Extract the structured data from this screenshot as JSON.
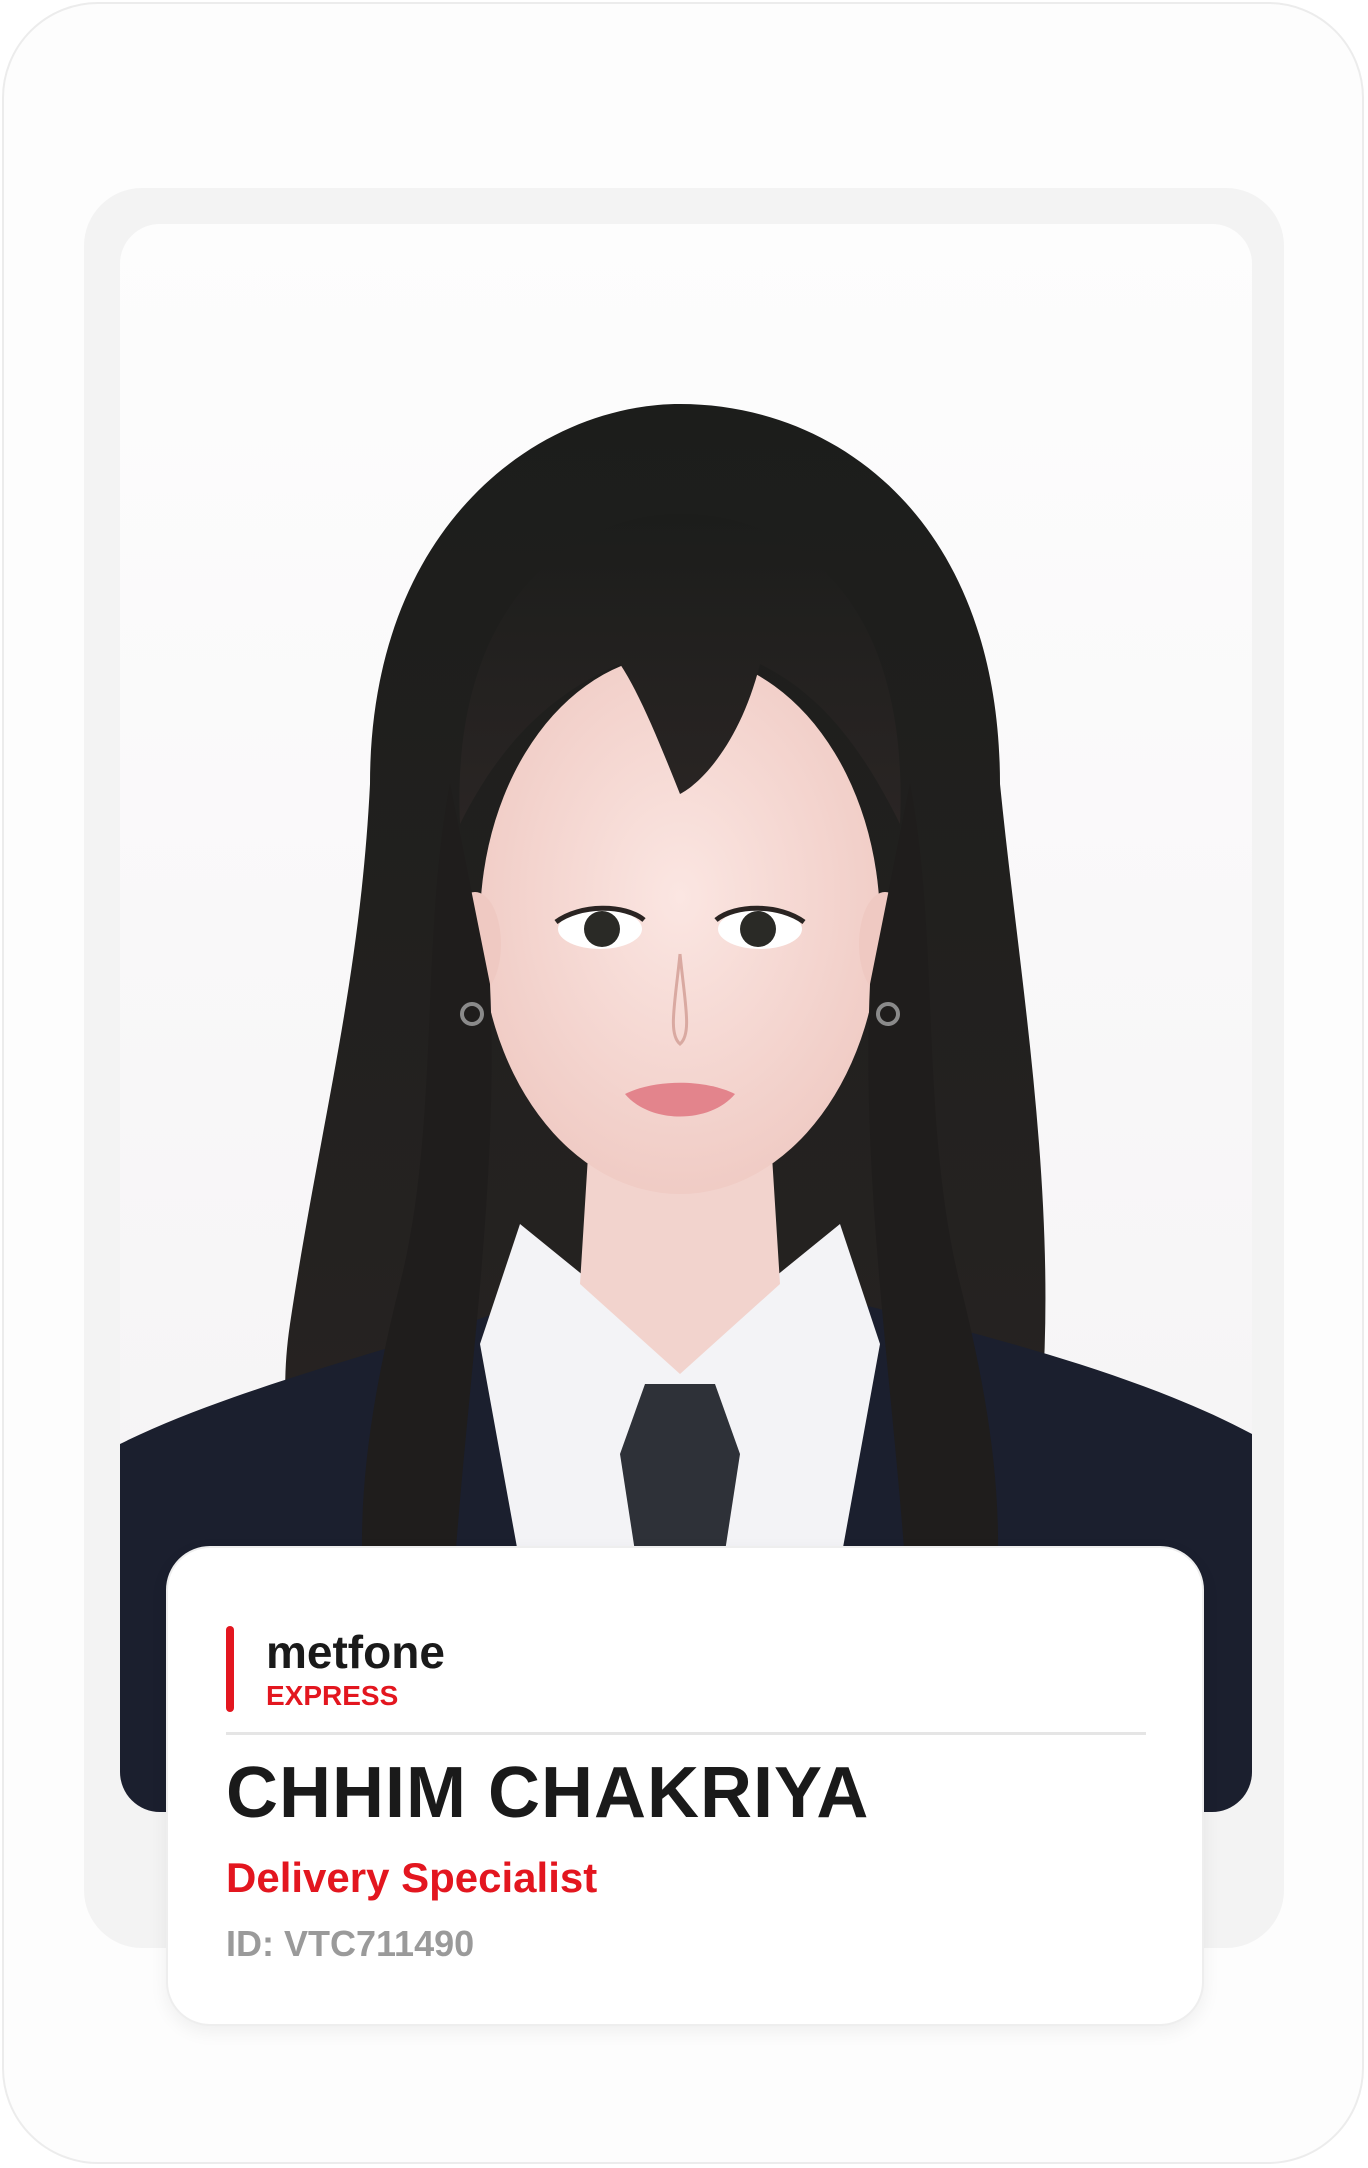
{
  "badge": {
    "brand_name": "metfone",
    "brand_sub": "EXPRESS",
    "person_name": "CHHIM CHAKRIYA",
    "job_title": "Delivery Specialist",
    "employee_id": "ID: VTC711490"
  },
  "colors": {
    "accent": "#e3161f",
    "text_dark": "#1a1a1a",
    "text_muted": "#9a9a9a",
    "blazer": "#1b1f2e",
    "background": "#ffffff"
  },
  "icons": {
    "portrait": "employee-portrait-photo"
  }
}
